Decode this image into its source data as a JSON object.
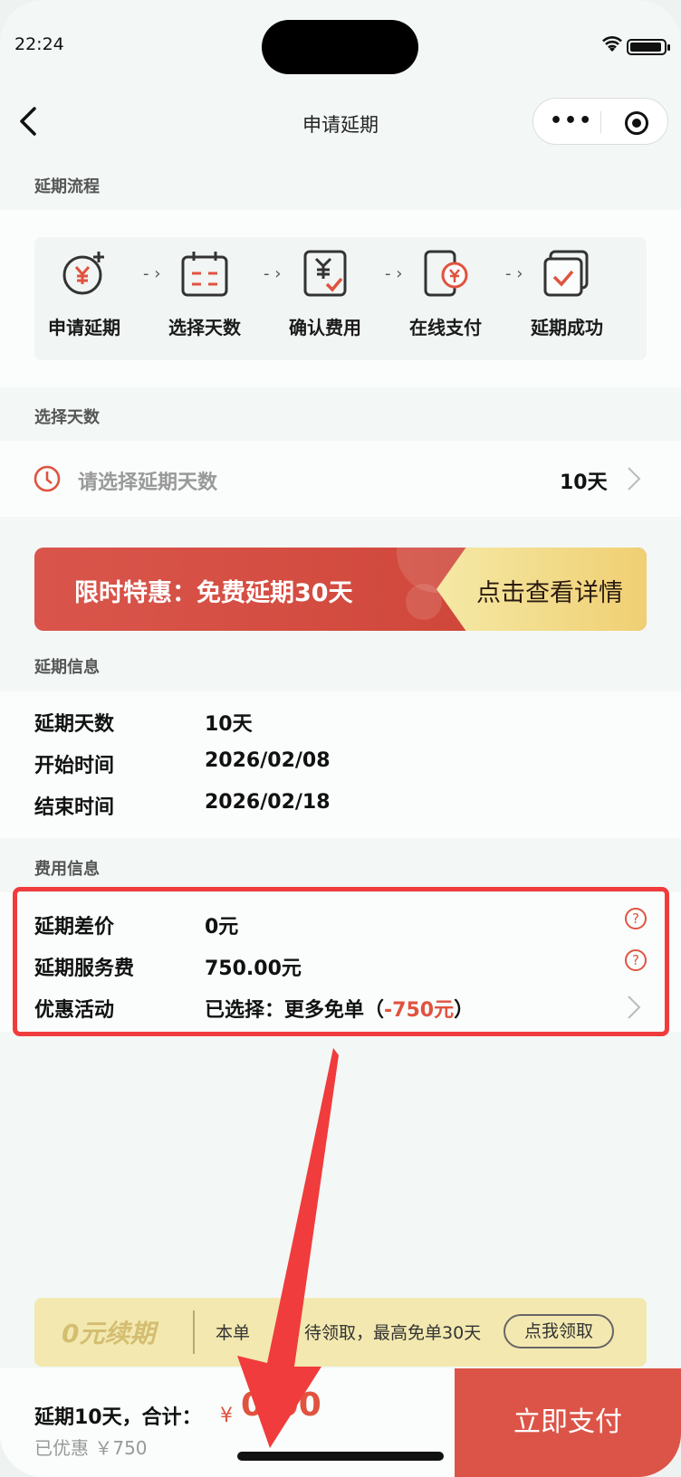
{
  "status": {
    "time": "22:24"
  },
  "nav": {
    "title": "申请延期",
    "menu_dots": "•••"
  },
  "flow": {
    "heading": "延期流程",
    "steps": [
      {
        "label": "申请延期",
        "icon": "yen-plus-icon"
      },
      {
        "label": "选择天数",
        "icon": "calendar-icon"
      },
      {
        "label": "确认费用",
        "icon": "bill-check-icon"
      },
      {
        "label": "在线支付",
        "icon": "phone-pay-icon"
      },
      {
        "label": "延期成功",
        "icon": "success-check-icon"
      }
    ],
    "arrow": "›"
  },
  "select_days": {
    "heading": "选择天数",
    "placeholder": "请选择延期天数",
    "value": "10天"
  },
  "promo": {
    "text": "限时特惠：免费延期30天",
    "button": "点击查看详情"
  },
  "extension_info": {
    "heading": "延期信息",
    "rows": [
      {
        "label": "延期天数",
        "value": "10天"
      },
      {
        "label": "开始时间",
        "value": "2026/02/08"
      },
      {
        "label": "结束时间",
        "value": "2026/02/18"
      }
    ]
  },
  "fee_info": {
    "heading": "费用信息",
    "rows": [
      {
        "label": "延期差价",
        "value": "0元"
      },
      {
        "label": "延期服务费",
        "value": "750.00元"
      },
      {
        "label": "优惠活动",
        "value_prefix": "已选择：更多免单（",
        "value_discount": "-750元",
        "value_suffix": "）"
      }
    ],
    "help_mark": "?"
  },
  "coupon": {
    "title": "0元续期",
    "desc": "本单",
    "desc_tail": "待领取，最高免单30天",
    "button": "点我领取"
  },
  "bottom": {
    "total_label": "延期10天，合计：",
    "currency": "¥",
    "amount": "0.00",
    "saved": "已优惠 ￥750",
    "pay_button": "立即支付"
  },
  "colors": {
    "accent": "#e0533f",
    "pay_button": "#dc5448",
    "highlight": "#f03c3c"
  }
}
